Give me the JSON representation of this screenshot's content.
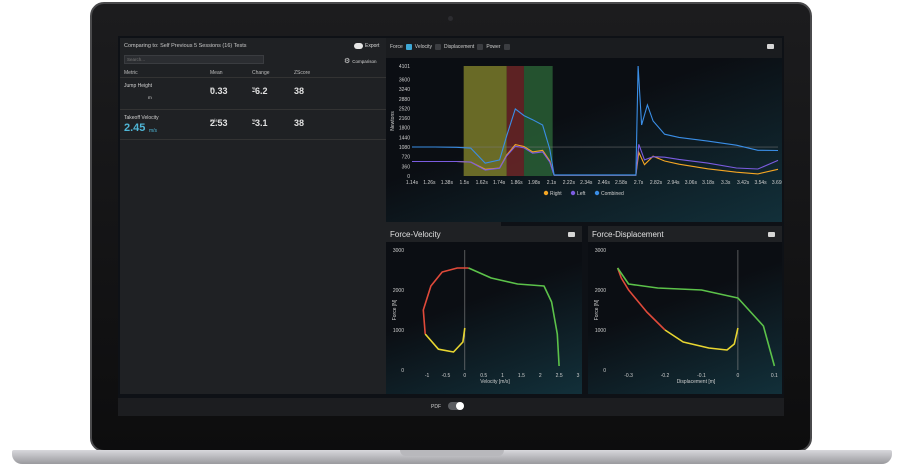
{
  "comparison": {
    "title": "Comparing to: Self Previous 5 Sessions (16) Tests",
    "export_label": "Export",
    "search_placeholder": "Search...",
    "comparison_label": "Comparison"
  },
  "table": {
    "headers": [
      "Metric",
      "Mean",
      "Change",
      "ZScore"
    ],
    "rows": [
      {
        "metric": "Jump Height",
        "value": "",
        "value_unit": "m",
        "mean": "0.33",
        "mean_unit": "m",
        "change": "-6.2",
        "change_unit": "%",
        "zscore": "38"
      },
      {
        "metric": "Takeoff Velocity",
        "value": "2.45",
        "value_unit": "m/s",
        "mean": "2.53",
        "mean_unit": "m/s",
        "change": "-3.1",
        "change_unit": "%",
        "zscore": "38"
      }
    ]
  },
  "top_chart": {
    "tabs": [
      "Force",
      "Velocity",
      "Displacement",
      "Power"
    ],
    "tab_checked": [
      true,
      false,
      false
    ]
  },
  "chart_data": [
    {
      "type": "line",
      "ylabel": "Newtons",
      "y_ticks": [
        "0",
        "360",
        "720",
        "1080",
        "1440",
        "1800",
        "2160",
        "2520",
        "2880",
        "3240",
        "3600",
        "4101"
      ],
      "x_ticks": [
        "1.14s",
        "1.26s",
        "1.38s",
        "1.5s",
        "1.62s",
        "1.74s",
        "1.86s",
        "1.98s",
        "2.1s",
        "2.22s",
        "2.34s",
        "2.46s",
        "2.58s",
        "2.7s",
        "2.82s",
        "2.94s",
        "3.06s",
        "3.18s",
        "3.3s",
        "3.42s",
        "3.54s",
        "3.69s"
      ],
      "ylim": [
        0,
        4101
      ],
      "bands": [
        {
          "from": "1.5s",
          "to": "1.8s",
          "color": "#8a8a2e"
        },
        {
          "from": "1.8s",
          "to": "1.92s",
          "color": "#7a2a2a"
        },
        {
          "from": "1.92s",
          "to": "2.12s",
          "color": "#2e6a3a"
        }
      ],
      "series": [
        {
          "name": "Right",
          "color": "#f5a623",
          "values": [
            [
              1.14,
              540
            ],
            [
              1.3,
              540
            ],
            [
              1.45,
              540
            ],
            [
              1.55,
              520
            ],
            [
              1.65,
              250
            ],
            [
              1.75,
              300
            ],
            [
              1.8,
              780
            ],
            [
              1.86,
              1170
            ],
            [
              1.92,
              1100
            ],
            [
              1.98,
              900
            ],
            [
              2.05,
              960
            ],
            [
              2.1,
              560
            ],
            [
              2.13,
              30
            ],
            [
              2.7,
              30
            ],
            [
              2.72,
              880
            ],
            [
              2.76,
              420
            ],
            [
              2.82,
              740
            ],
            [
              2.9,
              560
            ],
            [
              3.0,
              440
            ],
            [
              3.2,
              270
            ],
            [
              3.4,
              140
            ],
            [
              3.55,
              80
            ],
            [
              3.69,
              250
            ]
          ]
        },
        {
          "name": "Left",
          "color": "#7b5ce0",
          "values": [
            [
              1.14,
              540
            ],
            [
              1.3,
              540
            ],
            [
              1.45,
              540
            ],
            [
              1.55,
              520
            ],
            [
              1.65,
              220
            ],
            [
              1.75,
              290
            ],
            [
              1.8,
              750
            ],
            [
              1.86,
              1110
            ],
            [
              1.92,
              1050
            ],
            [
              1.98,
              850
            ],
            [
              2.05,
              900
            ],
            [
              2.1,
              520
            ],
            [
              2.13,
              30
            ],
            [
              2.7,
              30
            ],
            [
              2.72,
              1180
            ],
            [
              2.76,
              600
            ],
            [
              2.82,
              720
            ],
            [
              2.9,
              700
            ],
            [
              3.0,
              620
            ],
            [
              3.2,
              480
            ],
            [
              3.4,
              300
            ],
            [
              3.55,
              260
            ],
            [
              3.69,
              580
            ]
          ]
        },
        {
          "name": "Combined",
          "color": "#3a8ee6",
          "values": [
            [
              1.14,
              1080
            ],
            [
              1.3,
              1080
            ],
            [
              1.45,
              1070
            ],
            [
              1.55,
              1040
            ],
            [
              1.65,
              480
            ],
            [
              1.75,
              600
            ],
            [
              1.8,
              1500
            ],
            [
              1.86,
              2500
            ],
            [
              1.92,
              2250
            ],
            [
              1.98,
              2100
            ],
            [
              2.05,
              1900
            ],
            [
              2.1,
              1000
            ],
            [
              2.13,
              40
            ],
            [
              2.7,
              40
            ],
            [
              2.715,
              4101
            ],
            [
              2.74,
              1900
            ],
            [
              2.78,
              2650
            ],
            [
              2.82,
              2050
            ],
            [
              2.9,
              1560
            ],
            [
              3.0,
              1440
            ],
            [
              3.2,
              1300
            ],
            [
              3.4,
              1150
            ],
            [
              3.55,
              960
            ],
            [
              3.69,
              950
            ]
          ]
        }
      ],
      "legend": "bottom"
    },
    {
      "type": "line",
      "title": "Force-Velocity",
      "xlabel": "Velocity [m/s]",
      "ylabel": "Force [N]",
      "x_ticks": [
        "-1",
        "-0.5",
        "0",
        "0.5",
        "1",
        "1.5",
        "2",
        "2.5",
        "3"
      ],
      "y_ticks": [
        "0",
        "1000",
        "2000",
        "3000"
      ],
      "xlim": [
        -1.4,
        3
      ],
      "ylim": [
        0,
        3000
      ],
      "series": [
        {
          "name": "",
          "color": "#e8d631",
          "values": [
            [
              0,
              1050
            ],
            [
              -0.05,
              700
            ],
            [
              -0.3,
              450
            ],
            [
              -0.7,
              520
            ],
            [
              -1.05,
              900
            ]
          ]
        },
        {
          "name": "",
          "color": "#e04a3a",
          "values": [
            [
              -1.05,
              900
            ],
            [
              -1.1,
              1500
            ],
            [
              -0.9,
              2100
            ],
            [
              -0.6,
              2450
            ],
            [
              -0.2,
              2550
            ],
            [
              0.1,
              2550
            ]
          ]
        },
        {
          "name": "",
          "color": "#5cc24a",
          "values": [
            [
              0.1,
              2550
            ],
            [
              0.7,
              2300
            ],
            [
              1.4,
              2150
            ],
            [
              2.1,
              2100
            ],
            [
              2.3,
              1700
            ],
            [
              2.45,
              900
            ],
            [
              2.5,
              100
            ]
          ]
        }
      ]
    },
    {
      "type": "line",
      "title": "Force-Displacement",
      "xlabel": "Displacement [m]",
      "ylabel": "Force [N]",
      "x_ticks": [
        "-0.3",
        "-0.2",
        "-0.1",
        "0",
        "0.1"
      ],
      "y_ticks": [
        "0",
        "1000",
        "2000",
        "3000"
      ],
      "xlim": [
        -0.34,
        0.11
      ],
      "ylim": [
        0,
        3000
      ],
      "series": [
        {
          "name": "",
          "color": "#e04a3a",
          "values": [
            [
              -0.33,
              2550
            ],
            [
              -0.32,
              2300
            ],
            [
              -0.3,
              2000
            ],
            [
              -0.25,
              1450
            ],
            [
              -0.2,
              1000
            ]
          ]
        },
        {
          "name": "",
          "color": "#e8d631",
          "values": [
            [
              -0.2,
              1000
            ],
            [
              -0.15,
              700
            ],
            [
              -0.08,
              550
            ],
            [
              -0.03,
              500
            ],
            [
              -0.01,
              650
            ],
            [
              0,
              1050
            ]
          ]
        },
        {
          "name": "",
          "color": "#5cc24a",
          "values": [
            [
              -0.33,
              2550
            ],
            [
              -0.3,
              2150
            ],
            [
              -0.22,
              2050
            ],
            [
              -0.1,
              2000
            ],
            [
              0,
              1800
            ],
            [
              0.07,
              1100
            ],
            [
              0.1,
              100
            ]
          ]
        }
      ]
    }
  ],
  "pdf_label": "PDF"
}
